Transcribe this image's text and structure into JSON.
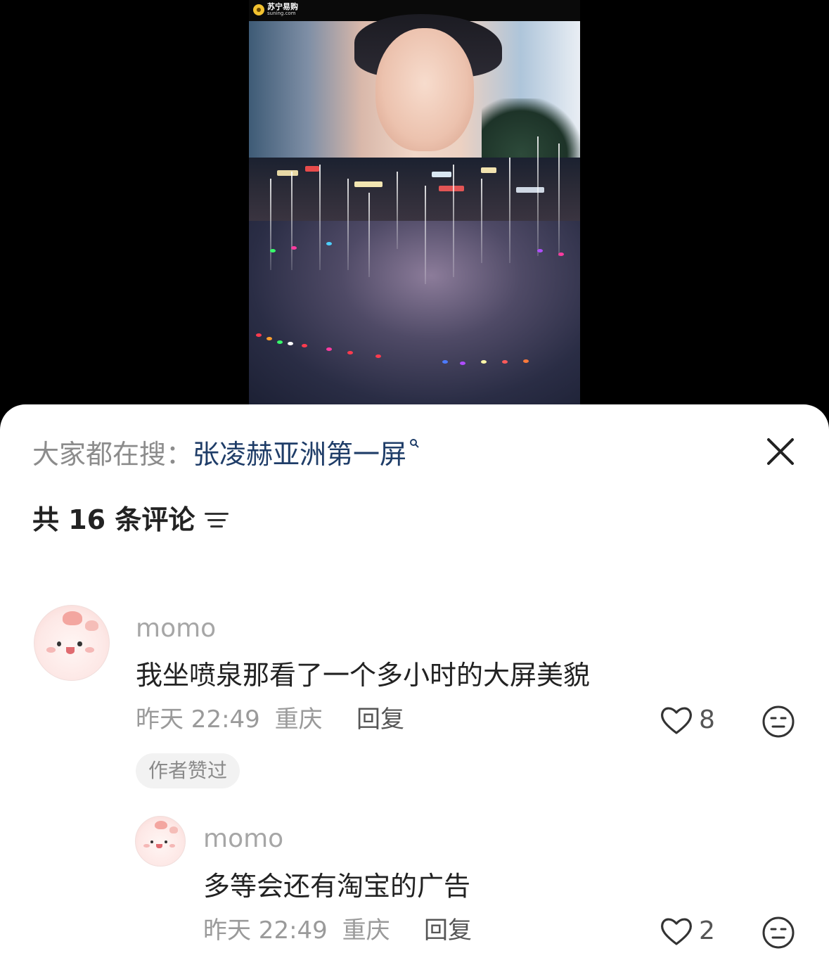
{
  "video": {
    "brand_name": "苏宁易购",
    "brand_domain": "suning.com"
  },
  "search": {
    "label": "大家都在搜：",
    "query": "张凌赫亚洲第一屏"
  },
  "comments_header": {
    "count_text": "共 16 条评论"
  },
  "comments": [
    {
      "username": "momo",
      "text": "我坐喷泉那看了一个多小时的大屏美貌",
      "time": "昨天 22:49",
      "location": "重庆",
      "reply_label": "回复",
      "likes": "8",
      "badge": "作者赞过"
    },
    {
      "username": "momo",
      "text": "多等会还有淘宝的广告",
      "time": "昨天 22:49",
      "location": "重庆",
      "reply_label": "回复",
      "likes": "2"
    }
  ],
  "icons": {
    "close": "close-icon",
    "sort": "sort-icon",
    "like": "heart-icon",
    "reaction": "emoji-icon",
    "search": "search-icon"
  },
  "colors": {
    "search_query": "#1f3d68",
    "muted_text": "#9a9a9a",
    "badge_bg": "#f2f2f2"
  }
}
